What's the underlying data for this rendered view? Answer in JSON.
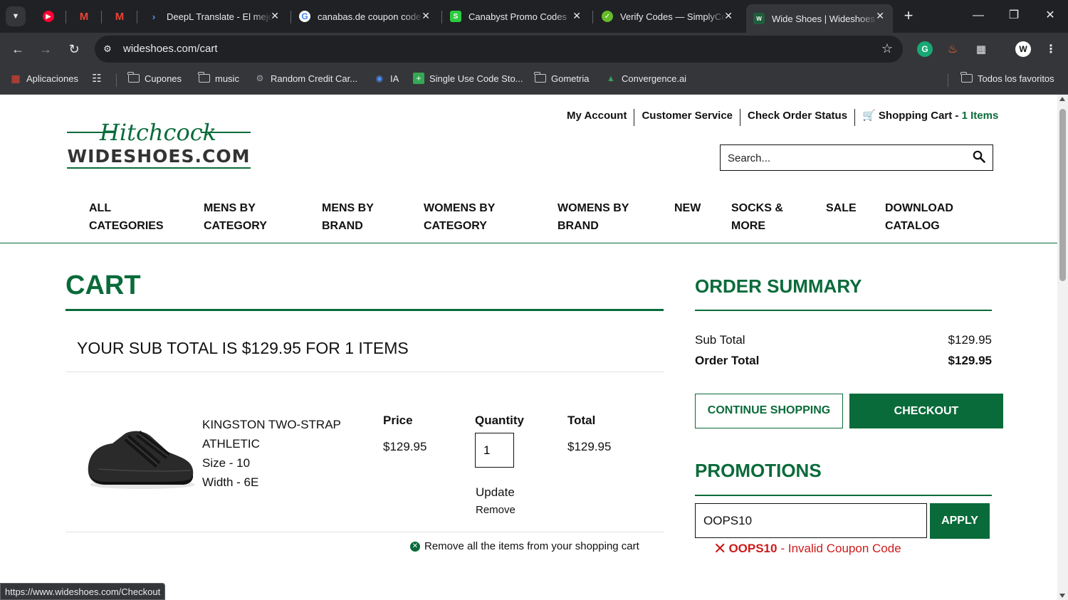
{
  "browser": {
    "tabs": [
      {
        "title": "",
        "icon": "youtube-music-icon",
        "color": "#ff0033"
      },
      {
        "title": "",
        "icon": "gmail-icon",
        "color": "#ea4335"
      },
      {
        "title": "",
        "icon": "gmail-icon",
        "color": "#ea4335"
      },
      {
        "title": "DeepL Translate - El mejor",
        "icon": "deepl-icon",
        "color": "#0f2b46"
      },
      {
        "title": "canabas.de coupon code",
        "icon": "google-icon",
        "color": "#4285f4"
      },
      {
        "title": "Canabyst Promo Codes",
        "icon": "canabyst-icon",
        "color": "#2ecc40"
      },
      {
        "title": "Verify Codes — SimplyCodes",
        "icon": "simplycodes-icon",
        "color": "#66bb2b"
      },
      {
        "title": "Wide Shoes | Wideshoes",
        "icon": "wideshoes-icon",
        "color": "#0a6b3a"
      }
    ],
    "url": "wideshoes.com/cart",
    "bookmarks": [
      {
        "label": "Aplicaciones",
        "icon": "apps-grid-icon"
      },
      {
        "label": "",
        "icon": "grid-icon"
      },
      {
        "label": "Cupones",
        "icon": "folder-icon"
      },
      {
        "label": "music",
        "icon": "folder-icon"
      },
      {
        "label": "Random Credit Car...",
        "icon": "gear-icon"
      },
      {
        "label": "IA",
        "icon": "globe-icon"
      },
      {
        "label": "Single Use Code Sto...",
        "icon": "plus-square-icon"
      },
      {
        "label": "Gometria",
        "icon": "folder-icon"
      },
      {
        "label": "Convergence.ai",
        "icon": "convergence-icon"
      }
    ],
    "all_bookmarks": "Todos los favoritos",
    "status_url": "https://www.wideshoes.com/Checkout"
  },
  "header": {
    "logo_top": "Hitchcock",
    "logo_bottom": "WIDESHOES.COM",
    "my_account": "My Account",
    "customer_service": "Customer Service",
    "check_order_status": "Check Order Status",
    "shopping_cart": "Shopping Cart -",
    "cart_count": "1 Items",
    "search_placeholder": "Search..."
  },
  "nav": [
    {
      "line1": "ALL",
      "line2": "CATEGORIES"
    },
    {
      "line1": "MENS BY",
      "line2": "CATEGORY"
    },
    {
      "line1": "MENS BY",
      "line2": "BRAND"
    },
    {
      "line1": "WOMENS BY",
      "line2": "CATEGORY"
    },
    {
      "line1": "WOMENS BY",
      "line2": "BRAND"
    },
    {
      "line1": "NEW",
      "line2": ""
    },
    {
      "line1": "SOCKS &",
      "line2": "MORE"
    },
    {
      "line1": "SALE",
      "line2": ""
    },
    {
      "line1": "DOWNLOAD",
      "line2": "CATALOG"
    }
  ],
  "cart": {
    "title": "CART",
    "subtotal_line": "YOUR SUB TOTAL IS $129.95 FOR 1 ITEMS",
    "item": {
      "name_line1": "KINGSTON TWO-STRAP",
      "name_line2": "ATHLETIC",
      "size": "Size - 10",
      "width": "Width - 6E",
      "price_label": "Price",
      "price": "$129.95",
      "quantity_label": "Quantity",
      "quantity": "1",
      "total_label": "Total",
      "total": "$129.95",
      "update": "Update",
      "remove": "Remove"
    },
    "remove_all": "Remove all the items from your shopping cart"
  },
  "summary": {
    "title": "ORDER SUMMARY",
    "sub_total_label": "Sub Total",
    "sub_total": "$129.95",
    "order_total_label": "Order Total",
    "order_total": "$129.95",
    "continue": "CONTINUE SHOPPING",
    "checkout": "CHECKOUT"
  },
  "promotions": {
    "title": "PROMOTIONS",
    "code_value": "OOPS10",
    "apply": "APPLY",
    "error_code": "OOPS10",
    "error_message": "- Invalid Coupon Code"
  },
  "colors": {
    "brand_green": "#0a6b3a",
    "error_red": "#cc1b1b"
  }
}
